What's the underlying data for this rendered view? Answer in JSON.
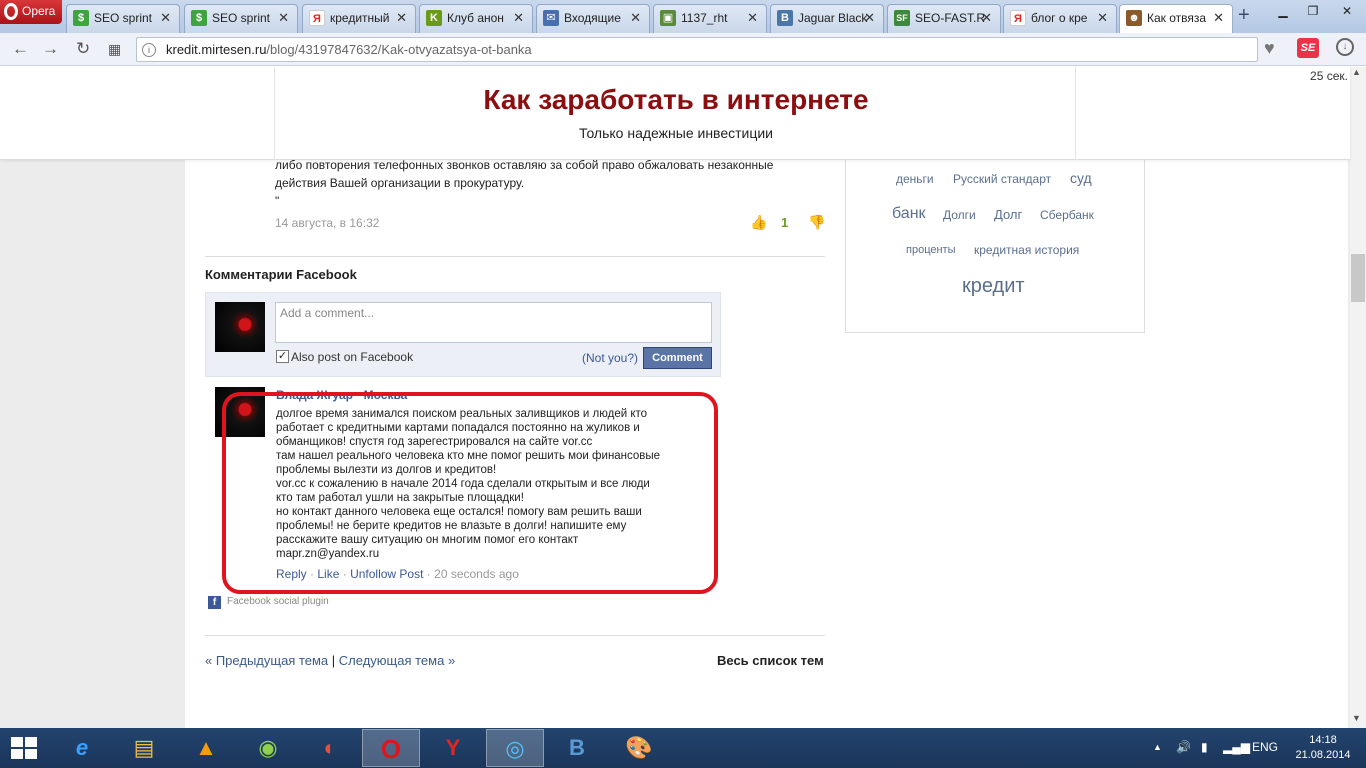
{
  "browser": {
    "menu_label": "Opera",
    "tabs": [
      {
        "title": "SEO sprint",
        "icon": "seosprint-icon",
        "color": "#3ea53e"
      },
      {
        "title": "SEO sprint",
        "icon": "seosprint-icon",
        "color": "#3ea53e"
      },
      {
        "title": "кредитный",
        "icon": "yandex-icon",
        "color": "#e52620"
      },
      {
        "title": "Клуб анон",
        "icon": "club-icon",
        "color": "#6a9a1a"
      },
      {
        "title": "Входящие",
        "icon": "mail-icon",
        "color": "#4a6fb0"
      },
      {
        "title": "1137_rht",
        "icon": "image-icon",
        "color": "#5a8a3a"
      },
      {
        "title": "Jaguar Black",
        "icon": "vk-icon",
        "color": "#4a76a8"
      },
      {
        "title": "SEO-FAST.R",
        "icon": "seofast-icon",
        "color": "#3a8a3a"
      },
      {
        "title": "блог о кре",
        "icon": "yandex-icon",
        "color": "#e52620"
      },
      {
        "title": "Как отвяза",
        "icon": "site-icon",
        "color": "#8b5a2b",
        "active": true
      }
    ],
    "url_host": "kredit.mirtesen.ru",
    "url_path": "/blog/43197847632/Kak-otvyazatsya-ot-banka"
  },
  "page": {
    "timer": "25 сек.",
    "site_title": "Как заработать в интернете",
    "site_subtitle": "Только надежные инвестиции",
    "prev_comment": {
      "lines": [
        "либо повторения телефонных звонков оставляю за собой право обжаловать незаконные",
        "действия Вашей организации в прокуратуру.",
        "\""
      ],
      "date": "14 августа, в 16:32",
      "votes": "1"
    },
    "fb": {
      "heading": "Комментарии Facebook",
      "placeholder": "Add a comment...",
      "also_post": "Also post on Facebook",
      "not_you": "(Not you?)",
      "comment_button": "Comment",
      "post": {
        "author": "Влада Жгуар · Москва",
        "lines": [
          "долгое время занимался поиском реальных заливщиков и людей кто",
          "работает с кредитными картами попадался постоянно на жуликов и",
          "обманщиков! спустя год зарегестрировался на сайте vor.cc",
          "там нашел реального человека кто мне помог решить мои финансовые",
          "проблемы вылезти из долгов и кредитов!",
          "vor.cc к сожалению в начале 2014 года сделали открытым и все люди",
          "кто там работал ушли на закрытые площадки!",
          "но контакт данного человека еще остался! помогу вам решить ваши",
          "проблемы! не берите кредитов не влазьте в долги! напишите ему",
          "расскажите вашу ситуацию он многим помог его контакт",
          "mapr.zn@yandex.ru"
        ],
        "reply": "Reply",
        "like": "Like",
        "unfollow": "Unfollow Post",
        "time": "20 seconds ago"
      },
      "plugin_label": "Facebook social plugin"
    },
    "nav": {
      "prev": "« Предыдущая тема",
      "next": "Следующая тема »",
      "all": "Весь список тем"
    },
    "tags": [
      {
        "label": "деньги"
      },
      {
        "label": "Русский стандарт"
      },
      {
        "label": "суд"
      },
      {
        "label": "банк"
      },
      {
        "label": "Долги"
      },
      {
        "label": "Долг"
      },
      {
        "label": "Сбербанк"
      },
      {
        "label": "проценты"
      },
      {
        "label": "кредитная история"
      },
      {
        "label": "кредит"
      }
    ]
  },
  "taskbar": {
    "apps": [
      "start-icon",
      "ie-icon",
      "explorer-icon",
      "avast-icon",
      "torrent-icon",
      "chrome-icon",
      "opera-icon",
      "yandex-browser-icon",
      "media-icon",
      "vk-icon",
      "paint-icon"
    ],
    "lang": "ENG",
    "time": "14:18",
    "date": "21.08.2014"
  }
}
